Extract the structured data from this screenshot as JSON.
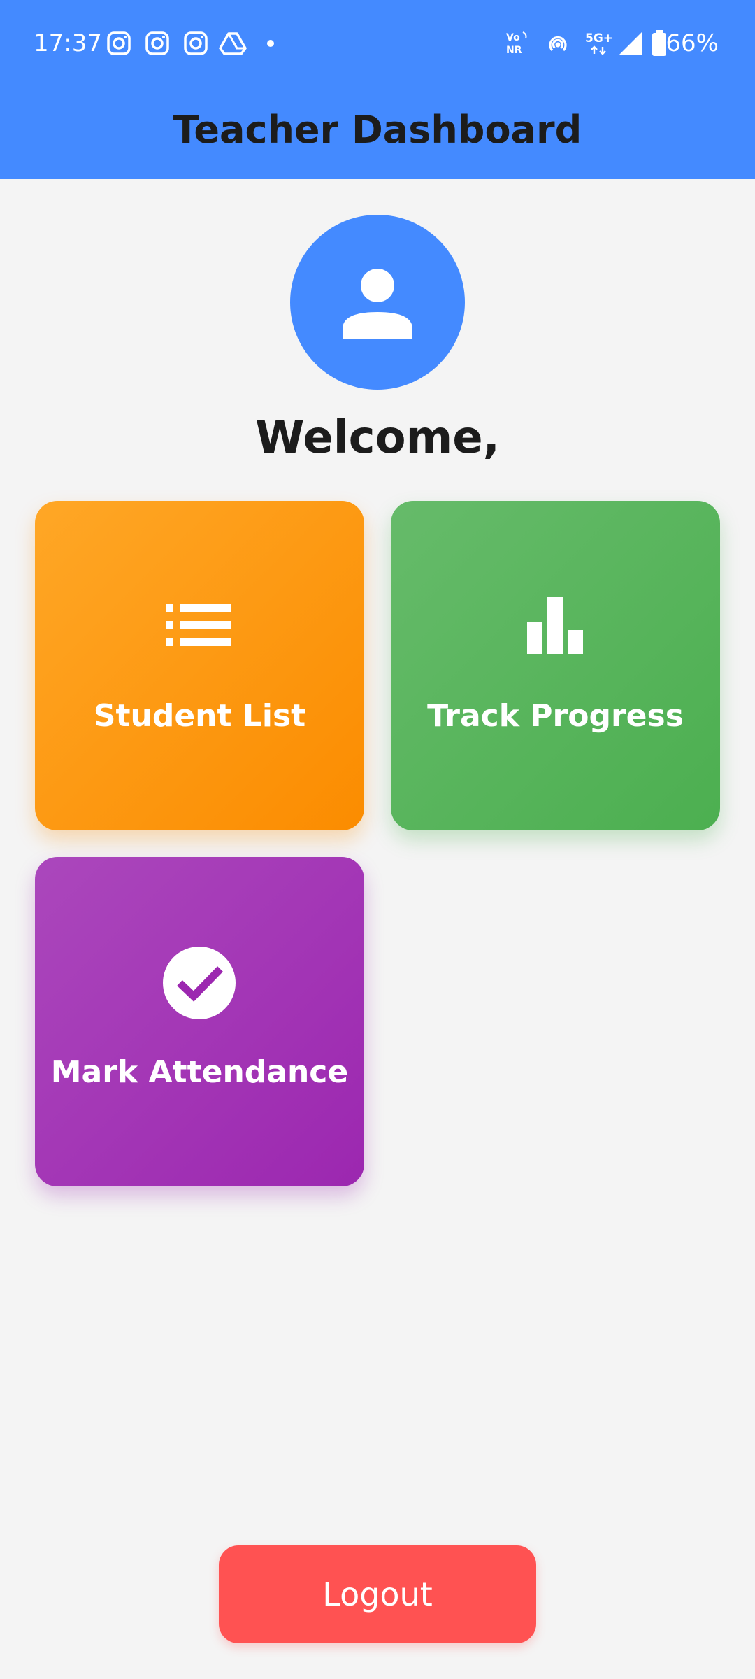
{
  "status_bar": {
    "time": "17:37",
    "battery": "66%",
    "left_icons": [
      "instagram-icon",
      "instagram-icon",
      "instagram-icon",
      "drive-icon",
      "dot-icon"
    ],
    "right_icons": [
      "vonr-icon",
      "hotspot-icon",
      "5g-plus-icon",
      "signal-icon",
      "battery-icon"
    ]
  },
  "header": {
    "title": "Teacher Dashboard"
  },
  "profile": {
    "avatar_icon": "person-icon",
    "welcome": "Welcome,"
  },
  "cards": [
    {
      "label": "Student List",
      "icon": "list-icon",
      "color_start": "#ffa726",
      "color_end": "#fb8c00"
    },
    {
      "label": "Track Progress",
      "icon": "bar-chart-icon",
      "color_start": "#66bb6a",
      "color_end": "#4caf50"
    },
    {
      "label": "Mark Attendance",
      "icon": "check-circle-icon",
      "color_start": "#ab47bc",
      "color_end": "#9c27b0"
    }
  ],
  "logout": {
    "label": "Logout",
    "color": "#ff5252"
  },
  "colors": {
    "primary": "#448aff",
    "background": "#f4f4f4",
    "title_text": "#1c1c1c"
  }
}
